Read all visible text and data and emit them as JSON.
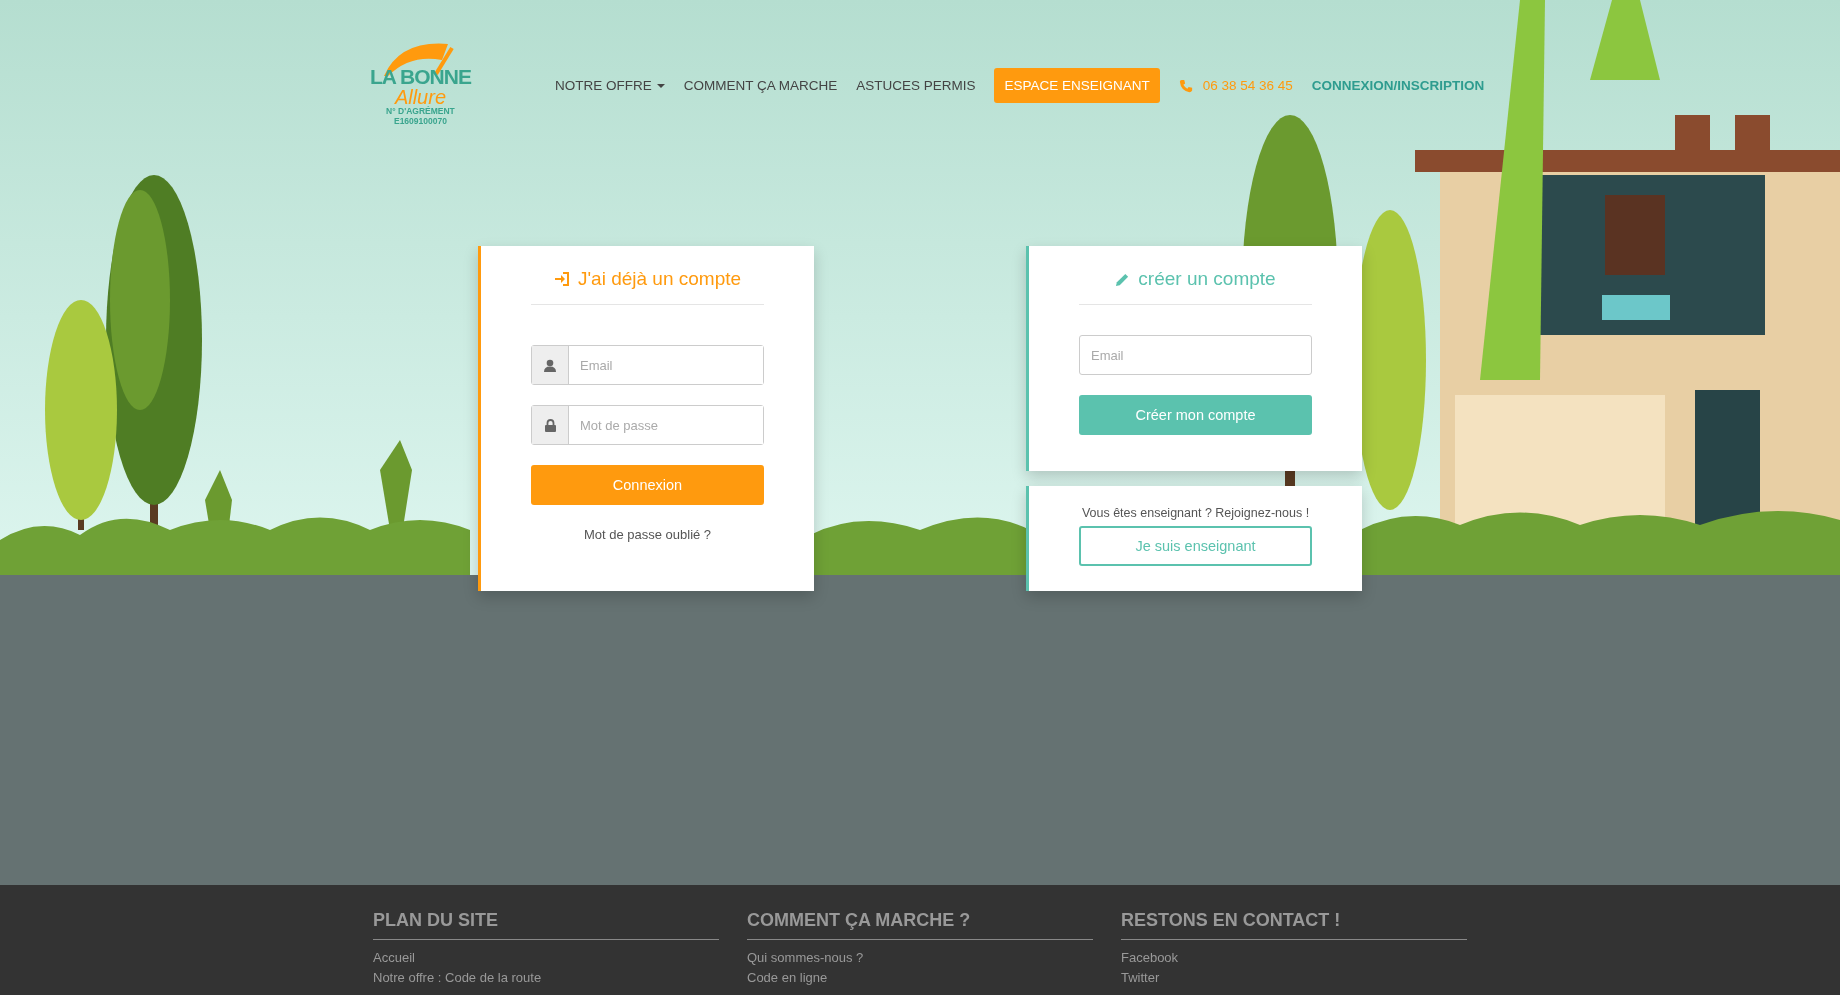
{
  "logo": {
    "name": "LA BONNE",
    "script": "Allure",
    "agrement": "N° D'AGRÉMENT",
    "number": "E1609100070"
  },
  "nav": [
    {
      "kind": "menu",
      "label": "NOTRE OFFRE"
    },
    {
      "kind": "link",
      "label": "COMMENT ÇA MARCHE"
    },
    {
      "kind": "link",
      "label": "ASTUCES PERMIS"
    },
    {
      "kind": "cta",
      "label": "ESPACE ENSEIGNANT"
    },
    {
      "kind": "phone",
      "label": "06 38 54 36 45"
    },
    {
      "kind": "account",
      "label": "CONNEXION/INSCRIPTION"
    }
  ],
  "login": {
    "title": "J'ai déjà un compte",
    "email_placeholder": "Email",
    "password_placeholder": "Mot de passe",
    "submit": "Connexion",
    "forgot": "Mot de passe oublié ?"
  },
  "signup": {
    "title": "créer un compte",
    "email_placeholder": "Email",
    "submit": "Créer mon compte"
  },
  "teacher": {
    "text": "Vous êtes enseignant ? Rejoignez-nous !",
    "button": "Je suis enseignant"
  },
  "footer": [
    {
      "title": "PLAN DU SITE",
      "links": [
        "Accueil",
        "Notre offre : Code de la route"
      ]
    },
    {
      "title": "COMMENT ÇA MARCHE ?",
      "links": [
        "Qui sommes-nous ?",
        "Code en ligne"
      ]
    },
    {
      "title": "RESTONS EN CONTACT !",
      "links": [
        "Facebook",
        "Twitter"
      ]
    }
  ]
}
